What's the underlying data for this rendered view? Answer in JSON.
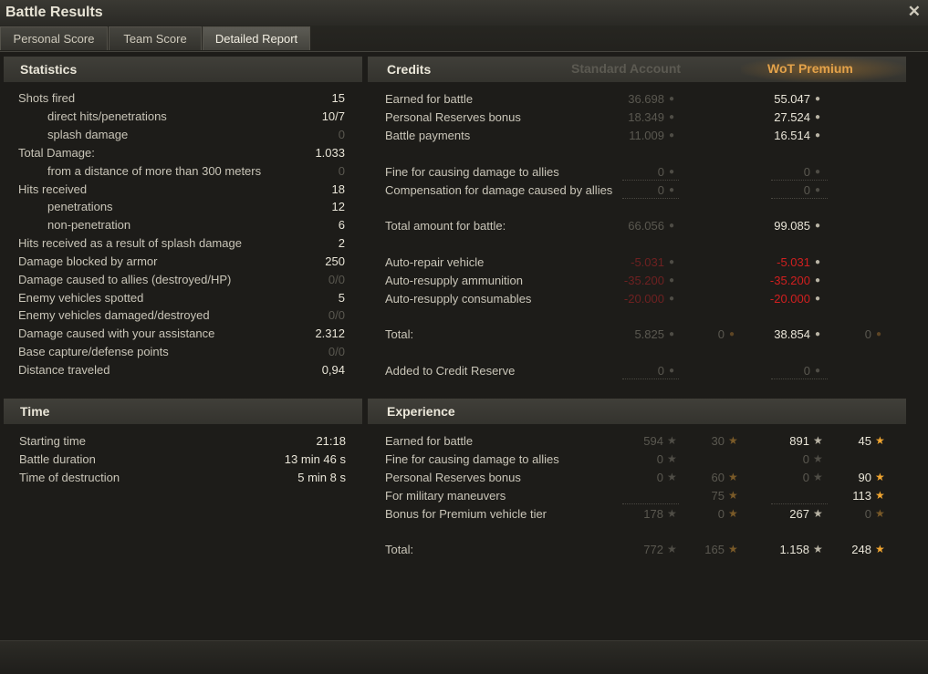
{
  "window": {
    "title": "Battle Results"
  },
  "tabs": [
    {
      "label": "Personal Score",
      "active": false
    },
    {
      "label": "Team Score",
      "active": false
    },
    {
      "label": "Detailed Report",
      "active": true
    }
  ],
  "statistics": {
    "title": "Statistics",
    "rows": [
      {
        "label": "Shots fired",
        "value": "15"
      },
      {
        "label": "direct hits/penetrations",
        "value": "10/7"
      },
      {
        "label": "splash damage",
        "value": "0"
      },
      {
        "label": "Total Damage:",
        "value": "1.033"
      },
      {
        "label": "from a distance of more than 300 meters",
        "value": "0"
      },
      {
        "label": "Hits received",
        "value": "18"
      },
      {
        "label": "penetrations",
        "value": "12"
      },
      {
        "label": "non-penetration",
        "value": "6"
      },
      {
        "label": "Hits received as a result of splash damage",
        "value": "2"
      },
      {
        "label": "Damage blocked by armor",
        "value": "250"
      },
      {
        "label": "Damage caused to allies (destroyed/HP)",
        "value": "0/0"
      },
      {
        "label": "Enemy vehicles spotted",
        "value": "5"
      },
      {
        "label": "Enemy vehicles damaged/destroyed",
        "value": "0/0"
      },
      {
        "label": "Damage caused with your assistance",
        "value": "2.312"
      },
      {
        "label": "Base capture/defense points",
        "value": "0/0"
      },
      {
        "label": "Distance traveled",
        "value": "0,94"
      }
    ]
  },
  "time": {
    "title": "Time",
    "rows": [
      {
        "label": "Starting time",
        "value": "21:18"
      },
      {
        "label": "Battle duration",
        "value": "13 min 46 s"
      },
      {
        "label": "Time of destruction",
        "value": "5 min 8 s"
      }
    ]
  },
  "credits": {
    "title": "Credits",
    "standard_label": "Standard Account",
    "premium_label": "WoT Premium",
    "rows": [
      {
        "label": "Earned for battle",
        "standard": "36.698",
        "premium": "55.047"
      },
      {
        "label": "Personal Reserves bonus",
        "standard": "18.349",
        "premium": "27.524"
      },
      {
        "label": "Battle payments",
        "standard": "11.009",
        "premium": "16.514"
      },
      {
        "label": "Fine for causing damage to allies",
        "standard": "0",
        "premium": "0"
      },
      {
        "label": "Compensation for damage caused by allies",
        "standard": "0",
        "premium": "0"
      },
      {
        "label": "Total amount for battle:",
        "standard": "66.056",
        "premium": "99.085"
      },
      {
        "label": "Auto-repair vehicle",
        "standard": "-5.031",
        "premium": "-5.031"
      },
      {
        "label": "Auto-resupply ammunition",
        "standard": "-35.200",
        "premium": "-35.200"
      },
      {
        "label": "Auto-resupply consumables",
        "standard": "-20.000",
        "premium": "-20.000"
      },
      {
        "label": "Total:",
        "standard": "5.825",
        "standard_gold": "0",
        "premium": "38.854",
        "premium_gold": "0"
      },
      {
        "label": "Added to Credit Reserve",
        "standard": "0",
        "premium": "0"
      }
    ]
  },
  "experience": {
    "title": "Experience",
    "rows": [
      {
        "label": "Earned for battle",
        "standard_xp": "594",
        "standard_free": "30",
        "premium_xp": "891",
        "premium_free": "45"
      },
      {
        "label": "Fine for causing damage to allies",
        "standard_xp": "0",
        "standard_free": "",
        "premium_xp": "0",
        "premium_free": ""
      },
      {
        "label": "Personal Reserves bonus",
        "standard_xp": "0",
        "standard_free": "60",
        "premium_xp": "0",
        "premium_free": "90"
      },
      {
        "label": "For military maneuvers",
        "standard_xp": "",
        "standard_free": "75",
        "premium_xp": "",
        "premium_free": "113"
      },
      {
        "label": "Bonus for Premium vehicle tier",
        "standard_xp": "178",
        "standard_free": "0",
        "premium_xp": "267",
        "premium_free": "0"
      },
      {
        "label": "Total:",
        "standard_xp": "772",
        "standard_free": "165",
        "premium_xp": "1.158",
        "premium_free": "248"
      }
    ]
  },
  "icons": {
    "credits": "credit-coin-icon",
    "gold": "gold-coin-icon",
    "xp": "experience-star-icon",
    "free_xp": "free-experience-star-icon",
    "close": "close-icon"
  },
  "colors": {
    "premium_header": "#e3a24a",
    "negative": "#d21f1f",
    "dimmed": "#5a5850"
  }
}
